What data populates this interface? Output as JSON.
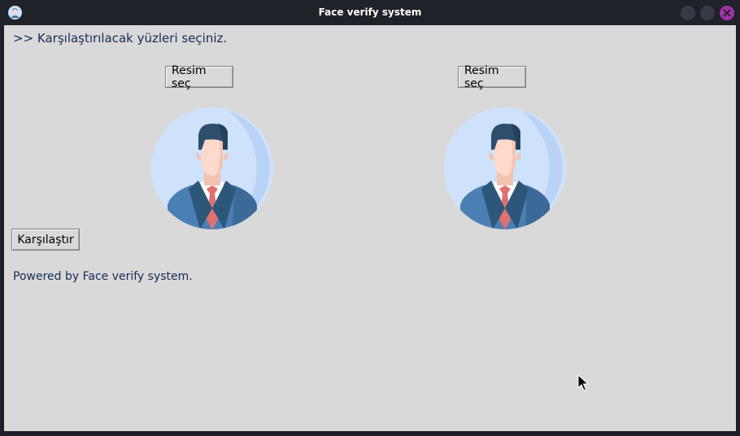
{
  "window": {
    "title": "Face verify system",
    "accent_close": "#a032a6"
  },
  "main": {
    "heading": ">> Karşılaştırılacak yüzleri seçiniz.",
    "left": {
      "select_label": "Resim seç",
      "avatar_icon": "person-avatar-icon"
    },
    "right": {
      "select_label": "Resim seç",
      "avatar_icon": "person-avatar-icon"
    },
    "compare_label": "Karşılaştır",
    "footer": "Powered by Face verify system."
  },
  "colors": {
    "text": "#1b2a55",
    "background": "#d9d9d9"
  }
}
